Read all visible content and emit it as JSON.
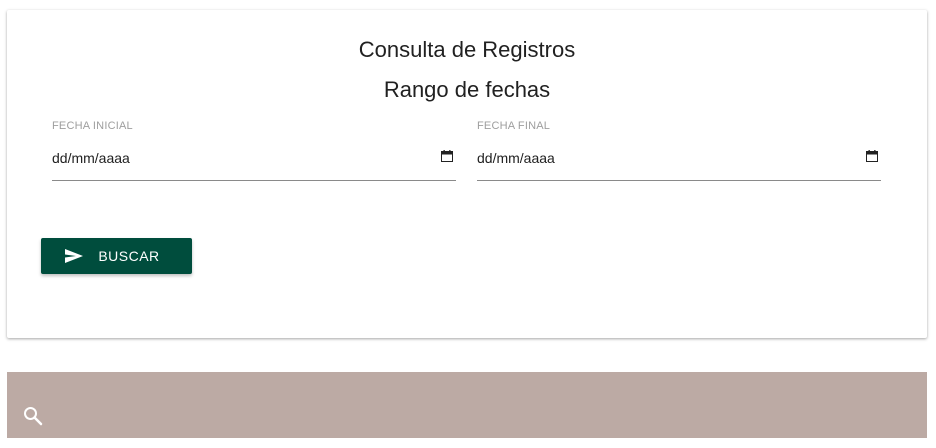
{
  "card": {
    "title": "Consulta de Registros",
    "subtitle": "Rango de fechas"
  },
  "fields": {
    "start": {
      "label": "FECHA INICIAL",
      "value": "dd/mm/aaaa"
    },
    "end": {
      "label": "FECHA FINAL",
      "value": "dd/mm/aaaa"
    }
  },
  "actions": {
    "search_label": "BUSCAR"
  },
  "icons": {
    "button_icon": "send-icon",
    "calendar_icon": "calendar-icon",
    "search_bar_icon": "search-icon"
  },
  "colors": {
    "button_bg": "#004d3d",
    "search_bar_bg": "#bcaaa4"
  }
}
